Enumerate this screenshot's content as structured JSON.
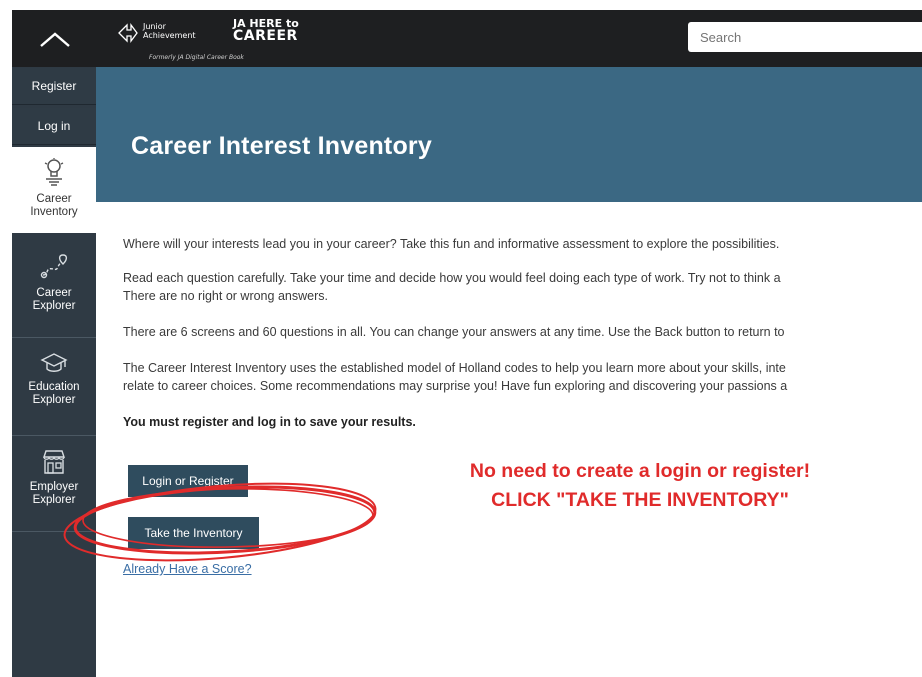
{
  "header": {
    "logo_line1": "Junior",
    "logo_line2": "Achievement",
    "logo_brand_top": "JA HERE to",
    "logo_brand_bottom": "CAREER",
    "logo_tagline": "Formerly JA Digital Career Book",
    "search_placeholder": "Search"
  },
  "sidebar": {
    "register": "Register",
    "login": "Log in",
    "items": [
      {
        "line1": "Career",
        "line2": "Inventory",
        "icon": "lightbulb-icon",
        "active": true
      },
      {
        "line1": "Career",
        "line2": "Explorer",
        "icon": "map-path-icon"
      },
      {
        "line1": "Education",
        "line2": "Explorer",
        "icon": "graduation-cap-icon"
      },
      {
        "line1": "Employer",
        "line2": "Explorer",
        "icon": "storefront-icon"
      }
    ]
  },
  "banner": {
    "title": "Career Interest Inventory"
  },
  "content": {
    "p1": "Where will your interests lead you in your career? Take this fun and informative assessment to explore the possibilities.",
    "p2a": "Read each question carefully. Take your time and decide how you would feel doing each type of work. Try not to think a",
    "p2b": "There are no right or wrong answers.",
    "p3": "There are 6 screens and 60 questions in all. You can change your answers at any time. Use the Back button to return to",
    "p4a": "The Career Interest Inventory uses the established model of Holland codes to help you learn more about your skills, inte",
    "p4b": "relate to career choices. Some recommendations may surprise you! Have fun exploring and discovering your passions a",
    "notice": "You must register and log in to save your results."
  },
  "buttons": {
    "login_register": "Login or Register",
    "take_inventory": "Take the Inventory",
    "already_score": "Already Have a Score?"
  },
  "callout": {
    "line1": "No need to create a login or register!",
    "line2": "CLICK \"TAKE THE INVENTORY\""
  },
  "colors": {
    "topbar": "#1e1f21",
    "sidebar": "#2f3a44",
    "banner": "#3b6883",
    "button": "#2f4c5e",
    "callout": "#e02b2b"
  }
}
